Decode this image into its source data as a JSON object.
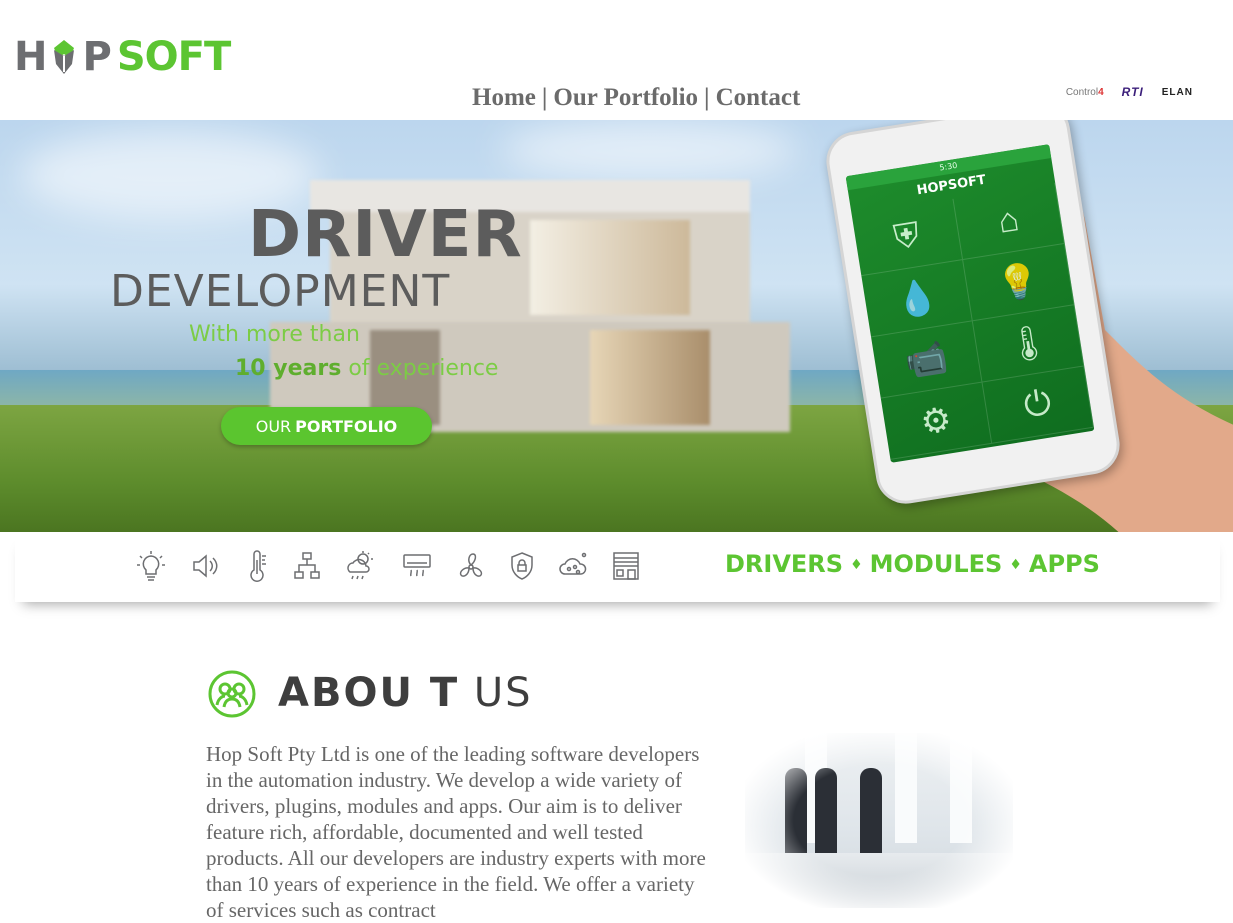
{
  "header": {
    "logo_text_left": "H",
    "logo_text_mid": "P",
    "logo_text_right": "SOFT",
    "nav": [
      {
        "label": "Home"
      },
      {
        "label": "Our Portfolio"
      },
      {
        "label": "Contact"
      }
    ],
    "nav_separator": "|",
    "brands": {
      "control4_text": "Control",
      "control4_mark": "4",
      "rti": "RTI",
      "elan": "ELAN"
    }
  },
  "hero": {
    "title": "DRIVER",
    "subtitle": "DEVELOPMENT",
    "line1": "With more than",
    "line2_bold": "10 years",
    "line2_rest": "of experience",
    "button_light": "OUR",
    "button_bold": "PORTFOLIO",
    "phone_time": "5:30",
    "phone_logo": "HOPSOFT"
  },
  "features": {
    "icons": [
      "light-bulb-icon",
      "speaker-icon",
      "thermometer-icon",
      "network-icon",
      "weather-icon",
      "air-conditioner-icon",
      "fan-icon",
      "security-lock-icon",
      "cloud-network-icon",
      "building-icon"
    ],
    "tagline": [
      "DRIVERS",
      "MODULES",
      "APPS"
    ]
  },
  "about": {
    "title_bold": "ABOU T",
    "title_light": "US",
    "text": "Hop Soft Pty Ltd is one of the leading software developers in the automation industry. We develop a wide variety of drivers, plugins, modules and apps. Our aim is to deliver feature rich, affordable, documented and well tested products. All our developers are industry experts with more than 10 years of experience in the field. We offer a variety of services such as contract"
  },
  "colors": {
    "brand_green": "#5cc532",
    "brand_grey": "#6d6e71"
  }
}
